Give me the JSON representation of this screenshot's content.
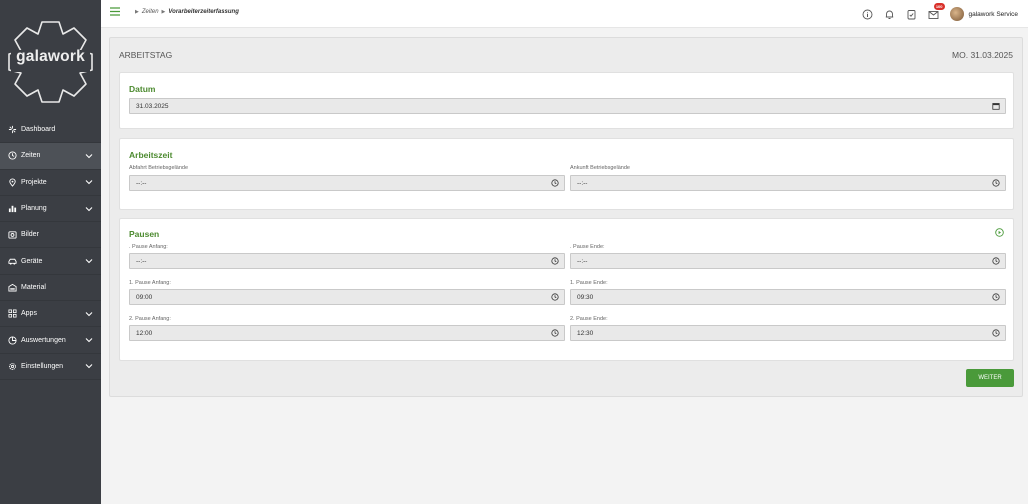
{
  "brand": {
    "name": "galawork"
  },
  "sidebar": {
    "items": [
      {
        "label": "Dashboard",
        "icon": "dashboard-icon",
        "chevron": false,
        "active": false
      },
      {
        "label": "Zeiten",
        "icon": "clock-icon",
        "chevron": true,
        "active": true
      },
      {
        "label": "Projekte",
        "icon": "location-pin-icon",
        "chevron": true,
        "active": false
      },
      {
        "label": "Planung",
        "icon": "bar-chart-icon",
        "chevron": true,
        "active": false
      },
      {
        "label": "Bilder",
        "icon": "camera-icon",
        "chevron": false,
        "active": false
      },
      {
        "label": "Geräte",
        "icon": "vehicle-icon",
        "chevron": true,
        "active": false
      },
      {
        "label": "Material",
        "icon": "inventory-icon",
        "chevron": false,
        "active": false
      },
      {
        "label": "Apps",
        "icon": "grid-icon",
        "chevron": true,
        "active": false
      },
      {
        "label": "Auswertungen",
        "icon": "analytics-icon",
        "chevron": true,
        "active": false
      },
      {
        "label": "Einstellungen",
        "icon": "gear-icon",
        "chevron": true,
        "active": false
      }
    ]
  },
  "topbar": {
    "breadcrumb": [
      "Zeiten",
      "Vorarbeiterzeiterfassung"
    ],
    "badge_count": "100",
    "user_name": "galawork Service"
  },
  "card": {
    "title": "ARBEITSTAG",
    "date": "MO. 31.03.2025"
  },
  "datum": {
    "title": "Datum",
    "value": "31.03.2025"
  },
  "arbeitszeit": {
    "title": "Arbeitszeit",
    "abfahrt_label": "Abfahrt Betriebsgelände",
    "abfahrt_value": "--:--",
    "ankunft_label": "Ankunft Betriebsgelände",
    "ankunft_value": "--:--"
  },
  "pausen": {
    "title": "Pausen",
    "rows": [
      {
        "start_label": ". Pause Anfang:",
        "start_value": "--:--",
        "end_label": ". Pause Ende:",
        "end_value": "--:--"
      },
      {
        "start_label": "1. Pause Anfang:",
        "start_value": "09:00",
        "end_label": "1. Pause Ende:",
        "end_value": "09:30"
      },
      {
        "start_label": "2. Pause Anfang:",
        "start_value": "12:00",
        "end_label": "2. Pause Ende:",
        "end_value": "12:30"
      }
    ]
  },
  "actions": {
    "weiter_label": "WEITER"
  },
  "colors": {
    "accent": "#4a9a3a",
    "sidebar": "#3b3e44",
    "title_green": "#4c8a2f",
    "badge": "#d9302a"
  }
}
